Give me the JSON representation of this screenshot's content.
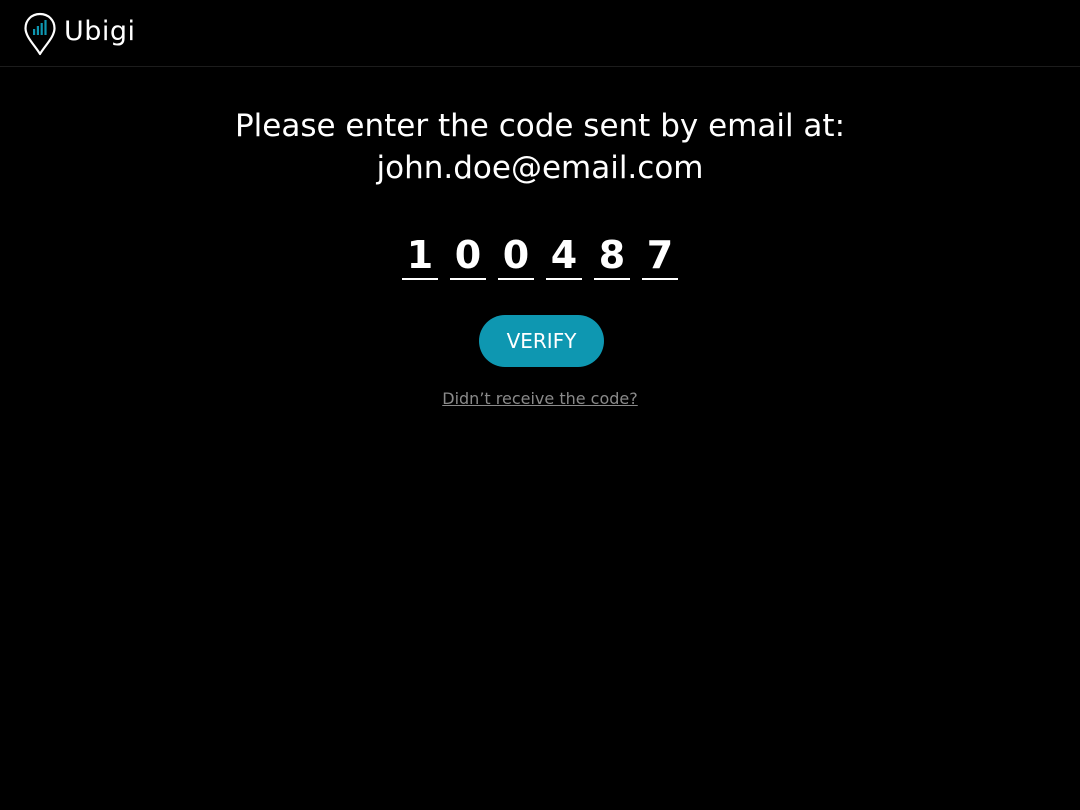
{
  "header": {
    "logo_text": "Ubigi",
    "logo_icon": "location-pin-signal-icon"
  },
  "verification": {
    "prompt": "Please enter the code sent by email at:",
    "email": "john.doe@email.com",
    "code_digits": [
      "1",
      "0",
      "0",
      "4",
      "8",
      "7"
    ],
    "verify_label": "VERIFY",
    "resend_label": "Didn’t receive the code?"
  },
  "colors": {
    "background": "#000000",
    "text": "#ffffff",
    "button": "#0e97b1",
    "link": "#8a8a8a"
  }
}
